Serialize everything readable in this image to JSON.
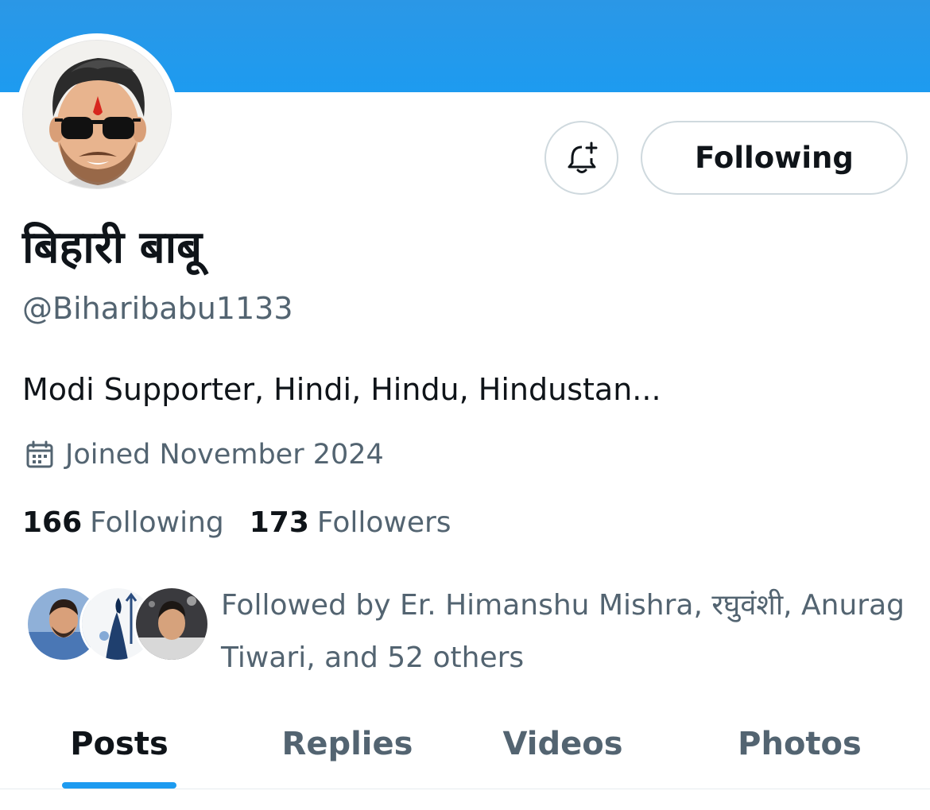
{
  "header": {
    "banner_color": "#1d9bf0"
  },
  "actions": {
    "notify_icon": "bell-plus-icon",
    "following_label": "Following"
  },
  "profile": {
    "display_name": "बिहारी बाबू",
    "handle": "@Biharibabu1133",
    "bio": "Modi Supporter, Hindi, Hindu, Hindustan...",
    "joined_icon": "calendar-icon",
    "joined": "Joined November 2024"
  },
  "stats": {
    "following_count": "166",
    "following_label": "Following",
    "followers_count": "173",
    "followers_label": "Followers"
  },
  "followed_by": {
    "text_line1": "Followed by Er. Himanshu Mishra, रघुवंशी, Anurag",
    "text_line2": "Tiwari, and 52 others"
  },
  "tabs": [
    {
      "label": "Posts",
      "active": true
    },
    {
      "label": "Replies",
      "active": false
    },
    {
      "label": "Videos",
      "active": false
    },
    {
      "label": "Photos",
      "active": false
    }
  ],
  "colors": {
    "accent": "#1d9bf0",
    "text_primary": "#0f1419",
    "text_secondary": "#536471",
    "border": "#cfd9de"
  }
}
